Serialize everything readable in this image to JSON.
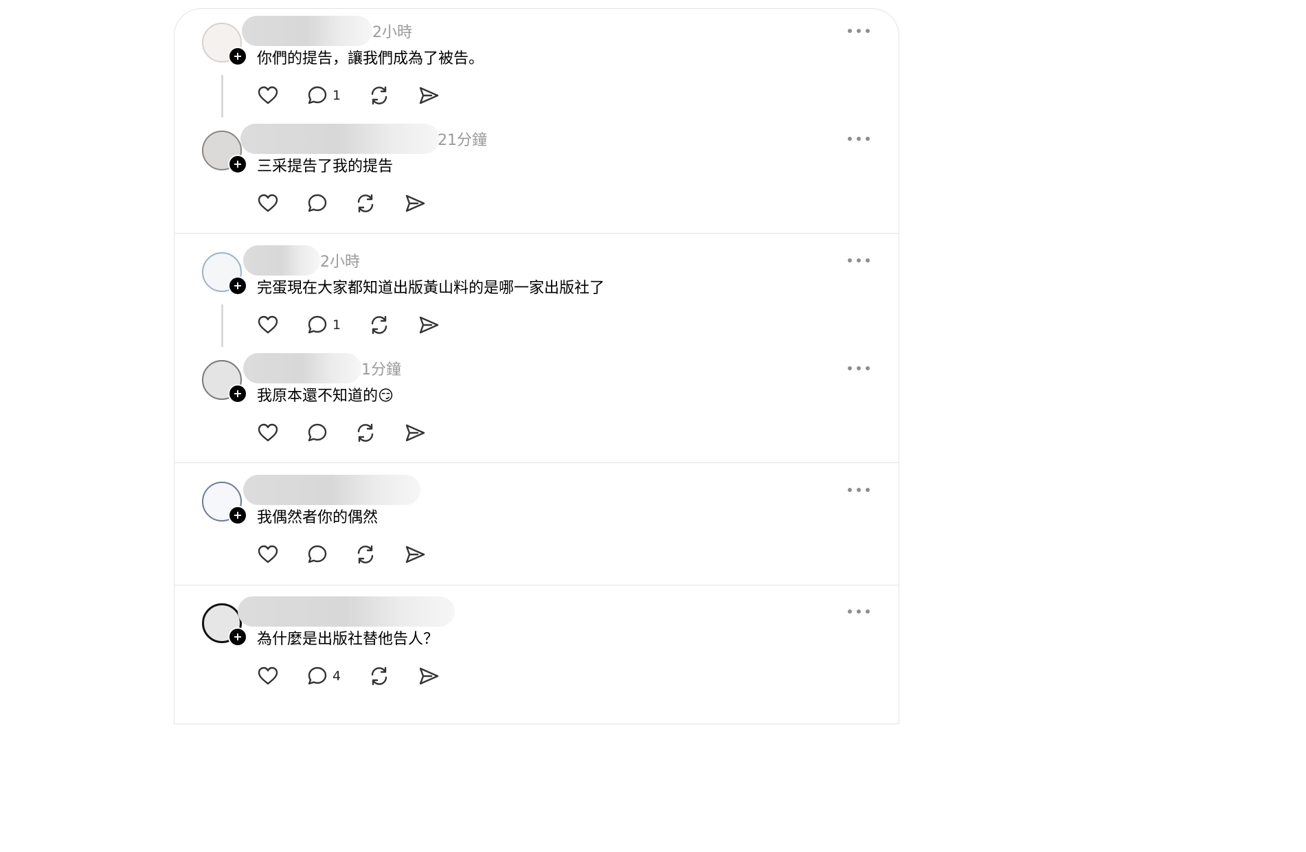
{
  "posts": [
    {
      "time": "2小時",
      "text": "你們的提告，讓我們成為了被告。",
      "reply_count": "1"
    },
    {
      "time": "21分鐘",
      "text": "三采提告了我的提告",
      "reply_count": ""
    },
    {
      "time": "2小時",
      "text": "完蛋現在大家都知道出版黃山料的是哪一家出版社了",
      "reply_count": "1"
    },
    {
      "time": "1分鐘",
      "text": "我原本還不知道的😏",
      "reply_count": ""
    },
    {
      "time": "",
      "text": "我偶然者你的偶然",
      "reply_count": ""
    },
    {
      "time": "",
      "text": "為什麼是出版社替他告人？",
      "reply_count": "4"
    }
  ],
  "icons": {
    "like": "heart-icon",
    "reply": "speech-bubble-icon",
    "repost": "repost-icon",
    "share": "send-icon",
    "more": "more-dots-icon",
    "follow": "plus-icon"
  },
  "colors": {
    "text": "#000000",
    "muted": "#9a9a9a",
    "divider": "#e3e3e3",
    "icon": "#333333"
  }
}
